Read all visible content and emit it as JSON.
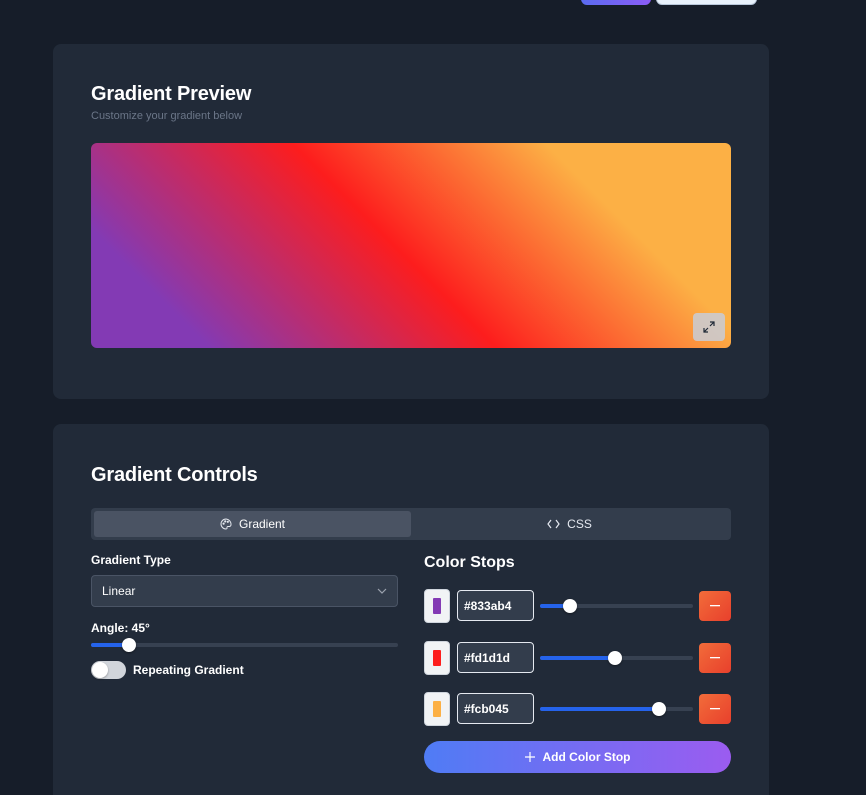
{
  "header": {},
  "preview": {
    "title": "Gradient Preview",
    "subtitle": "Customize your gradient below"
  },
  "controls": {
    "title": "Gradient Controls",
    "tabs": [
      {
        "label": "Gradient",
        "icon": "palette-icon",
        "active": true
      },
      {
        "label": "CSS",
        "icon": "code-icon",
        "active": false
      }
    ],
    "type_label": "Gradient Type",
    "type_value": "Linear",
    "angle_label": "Angle: 45°",
    "angle_value": 45,
    "repeating_label": "Repeating Gradient",
    "repeating_on": false,
    "stops_title": "Color Stops",
    "stops": [
      {
        "color": "#833ab4",
        "hex": "#833ab4",
        "position": 0.2
      },
      {
        "color": "#fd1d1d",
        "hex": "#fd1d1d",
        "position": 0.49
      },
      {
        "color": "#fcb045",
        "hex": "#fcb045",
        "position": 0.78
      }
    ],
    "add_label": "Add Color Stop"
  },
  "colors": {
    "background": "#161d29",
    "card": "#212a38",
    "accent": "#2563eb",
    "danger": "#ea4c2f"
  }
}
